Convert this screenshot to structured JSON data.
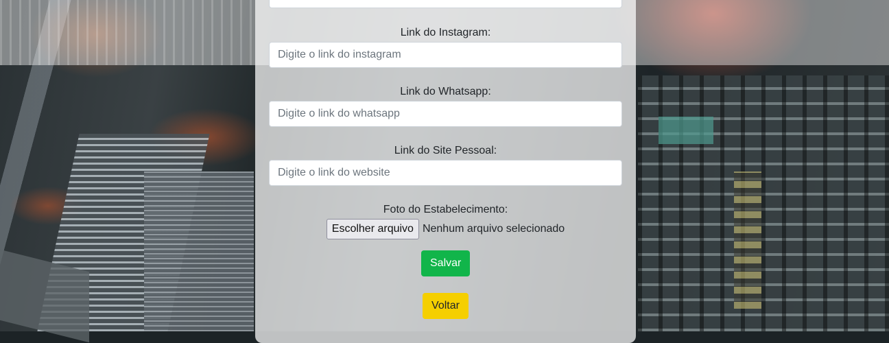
{
  "form": {
    "instagram": {
      "label": "Link do Instagram:",
      "placeholder": "Digite o link do instagram",
      "value": ""
    },
    "whatsapp": {
      "label": "Link do Whatsapp:",
      "placeholder": "Digite o link do whatsapp",
      "value": ""
    },
    "website": {
      "label": "Link do Site Pessoal:",
      "placeholder": "Digite o link do website",
      "value": ""
    },
    "photo": {
      "label": "Foto do Estabelecimento:",
      "choose_button": "Escolher arquivo",
      "status": "Nenhum arquivo selecionado"
    },
    "save_button": "Salvar",
    "back_button": "Voltar"
  },
  "colors": {
    "save": "#11b54a",
    "back": "#f5cf00"
  }
}
